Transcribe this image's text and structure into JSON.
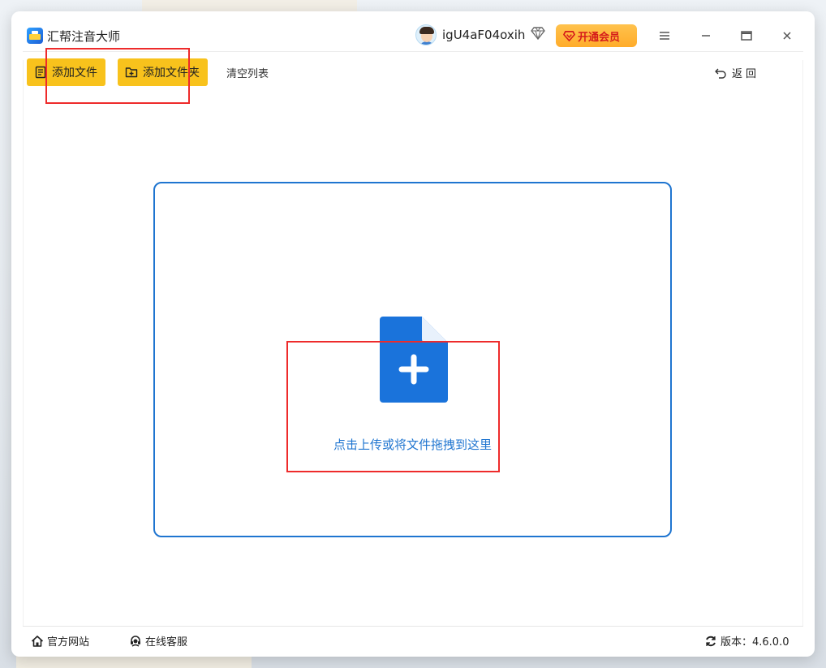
{
  "app": {
    "title": "汇帮注音大师"
  },
  "user": {
    "name": "igU4aF04oxih"
  },
  "header": {
    "vip_label": "开通会员"
  },
  "toolbar": {
    "add_file_label": "添加文件",
    "add_folder_label": "添加文件夹",
    "clear_list_label": "清空列表",
    "back_label": "返回"
  },
  "dropzone": {
    "hint": "点击上传或将文件拖拽到这里"
  },
  "footer": {
    "website_label": "官方网站",
    "support_label": "在线客服",
    "version_label": "版本：4.6.0.0"
  },
  "icons": {
    "app": "app-logo-icon",
    "diamond": "diamond-icon",
    "vip": "diamond-heart-icon",
    "menu": "hamburger-menu-icon",
    "minimize": "minimize-icon",
    "maximize": "maximize-icon",
    "close": "close-icon",
    "add_file": "document-icon",
    "add_folder": "folder-plus-icon",
    "back": "undo-arrow-icon",
    "upload": "file-plus-icon",
    "home": "home-icon",
    "support": "headset-icon",
    "refresh": "refresh-icon"
  },
  "colors": {
    "accent_yellow": "#f8c21c",
    "primary_blue": "#1f75d0",
    "vip_red": "#d51b1b",
    "annotation_red": "#ee2b2b"
  }
}
